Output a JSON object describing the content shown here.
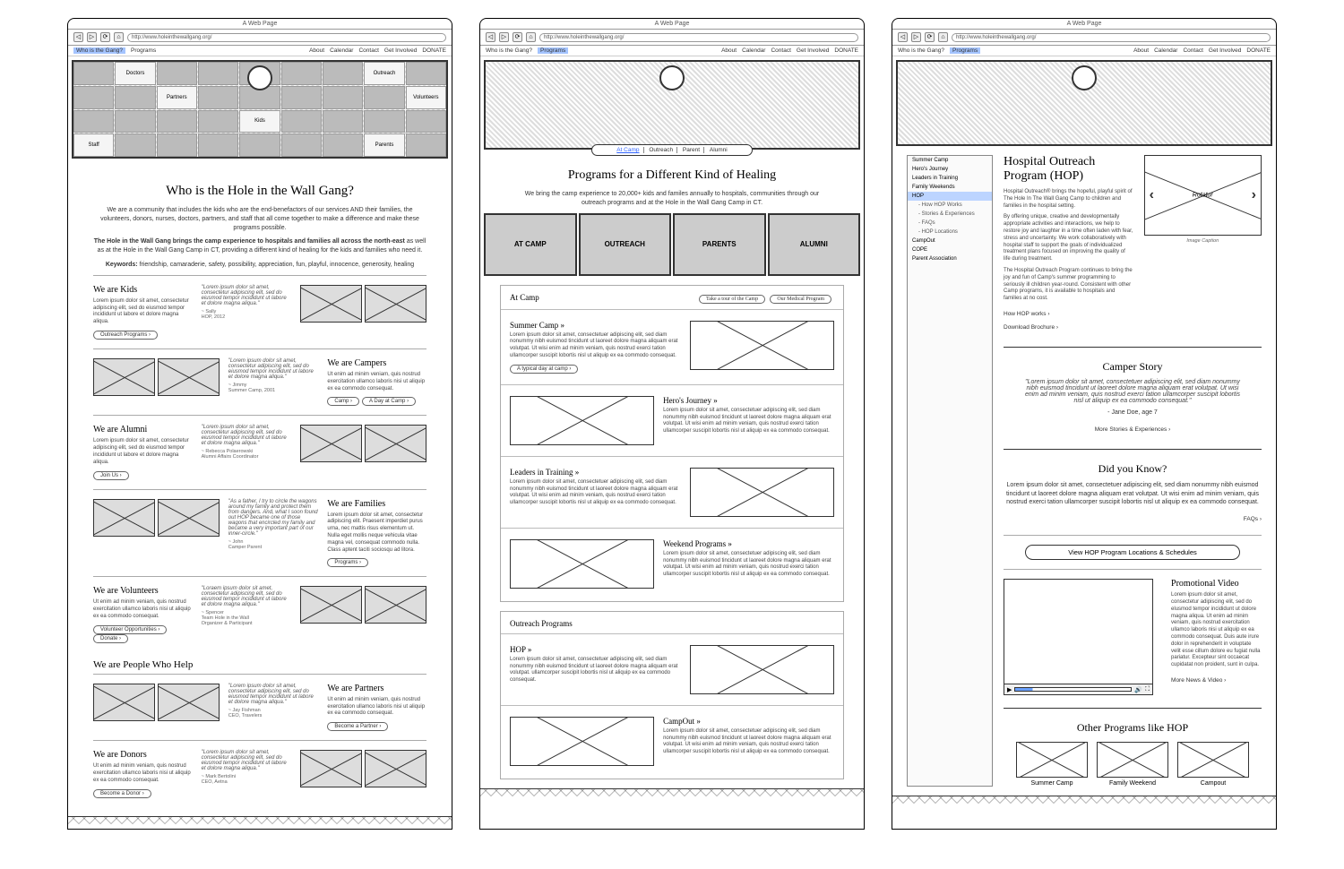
{
  "browser": {
    "title": "A Web Page",
    "url": "http://www.holeinthewallgang.org/"
  },
  "nav": {
    "left": [
      "Who is the Gang?",
      "Programs"
    ],
    "right": [
      "About",
      "Calendar",
      "Contact",
      "Get Involved",
      "DONATE"
    ]
  },
  "page1": {
    "title": "Who is the Hole in the Wall Gang?",
    "intro1": "We are a community that includes the kids who are the end-benefactors of our services AND their families, the volunteers, donors, nurses, doctors, partners, and staff that all come together to make a difference and make these programs possible.",
    "intro2_bold": "The Hole in the Wall Gang brings the camp experience to hospitals and families all across the north-east",
    "intro2_rest": " as well as at the Hole in the Wall Gang Camp in CT, providing a different kind of healing for the kids and families who need it.",
    "keywords_label": "Keywords:",
    "keywords": "friendship, camaraderie, safety, possibility, appreciation, fun, playful, innocence, generosity, healing",
    "facelabels": [
      "Doctors",
      "Partners",
      "Kids",
      "Staff",
      "Outreach",
      "Volunteers",
      "Parents"
    ],
    "sections": [
      {
        "title": "We are Kids",
        "body": "Lorem ipsum dolor sit amet, consectetur adipiscing elit, sed do eiusmod tempor incididunt ut labore et dolore magna aliqua.",
        "quote": "\"Lorem ipsum dolor sit amet, consectetur adipiscing elit, sed do eiusmod tempor incididunt ut labore et dolore magna aliqua.\"",
        "attr": "~ Sally\nHOP, 2012",
        "buttons": [
          "Outreach Programs"
        ]
      },
      {
        "title": "We are Campers",
        "body": "Ut enim ad minim veniam, quis nostrud exercitation ullamco laboris nisi ut aliquip ex ea commodo consequat.",
        "quote": "\"Lorem ipsum dolor sit amet, consectetur adipiscing elit, sed do eiusmod tempor incididunt ut labore et dolore magna aliqua.\"",
        "attr": "~ Jimmy\nSummer Camp, 2001",
        "buttons": [
          "Camp",
          "A Day at Camp"
        ]
      },
      {
        "title": "We are Alumni",
        "body": "Lorem ipsum dolor sit amet, consectetur adipiscing elit, sed do eiusmod tempor incididunt ut labore et dolore magna aliqua.",
        "quote": "\"Lorem ipsum dolor sit amet, consectetur adipiscing elit, sed do eiusmod tempor incididunt ut labore et dolore magna aliqua.\"",
        "attr": "~ Rebecca Polaerowski\nAlumni Affairs Coordinator",
        "buttons": [
          "Join Us"
        ]
      },
      {
        "title": "We are Families",
        "body": "Lorem ipsum dolor sit amet, consectetur adipiscing elit. Praesent imperdiet purus urna, nec mattis risus elementum ut. Nulla eget mollis neque vehicula vitae magna vel, consequat commodo nulla. Class aptent taciti sociosqu ad litora.",
        "quote": "\"As a father, I try to circle the wagons around my family and protect them from dangers. And, what I soon found out HOP became one of those wagons that encircled my family and became a very important part of our inner-circle.\"",
        "attr": "~ John\nCamper Parent",
        "buttons": [
          "Programs"
        ]
      },
      {
        "title": "We are Volunteers",
        "body": "Ut enim ad minim veniam, quis nostrud exercitation ullamco laboris nisi ut aliquip ex ea commodo consequat.",
        "quote": "\"Loraem ipsum dolor sit amet, consectetur adipiscing elit, sed do eiusmod tempor incididunt ut labore et dolore magna aliqua.\"",
        "attr": "~ Spencer\nTeam Hole in the Wall\nOrganizer & Participant",
        "buttons": [
          "Volunteer Opportunities",
          "Donate"
        ]
      },
      {
        "super": "We are People Who Help",
        "title": "We are Partners",
        "body": "Ut enim ad minim veniam, quis nostrud exercitation ullamco laboris nisi ut aliquip ex ea commodo consequat.",
        "quote": "\"Lorem ipsum dolor sit amet, consectetur adipiscing elit, sed do eiusmod tempor incididunt ut labore et dolore magna aliqua.\"",
        "attr": "~ Jay Fishman\nCEO, Travelers",
        "buttons": [
          "Become a Partner"
        ]
      },
      {
        "title": "We are Donors",
        "body": "Ut enim ad minim veniam, quis nostrud exercitation ullamco laboris nisi ut aliquip ex ea commodo consequat.",
        "quote": "\"Lorem ipsum dolor sit amet, consectetur adipiscing elit, sed do eiusmod tempor incididunt ut labore et dolore magna aliqua.\"",
        "attr": "~ Mark Bertolini\nCEO, Aetna",
        "buttons": [
          "Become a Donor"
        ]
      }
    ]
  },
  "page2": {
    "title": "Programs for a Different Kind of Healing",
    "intro": "We bring the camp experience to 20,000+ kids and familes annually to hospitals, communities through our outreach programs and at the Hole in the Wall Gang Camp in CT.",
    "pillbar": [
      "At Camp",
      "Outreach",
      "Parent",
      "Alumni"
    ],
    "thumbs": [
      "AT CAMP",
      "OUTREACH",
      "PARENTS",
      "ALUMNI"
    ],
    "atcamp": {
      "heading": "At Camp",
      "btns": [
        "Take a tour of the Camp",
        "Our Medical Program"
      ],
      "items": [
        {
          "t": "Summer Camp »",
          "b": "Lorem ipsum dolor sit amet, consectetuer adipiscing elit, sed diam nonummy nibh euismod tincidunt ut laoreet dolore magna aliquam erat volutpat. Ut wisi enim ad minim veniam, quis nostrud exerci tation ullamcorper suscipit lobortis nisl ut aliquip ex ea commodo consequat.",
          "pill": "A typical day at camp"
        },
        {
          "t": "Hero's Journey »",
          "b": "Lorem ipsum dolor sit amet, consectetuer adipiscing elit, sed diam nonummy nibh euismod tincidunt ut laoreet dolore magna aliquam erat volutpat. Ut wisi enim ad minim veniam, quis nostrud exerci tation ullamcorper suscipit lobortis nisl ut aliquip ex ea commodo consequat."
        },
        {
          "t": "Leaders in Training »",
          "b": "Lorem ipsum dolor sit amet, consectetuer adipiscing elit, sed diam nonummy nibh euismod tincidunt ut laoreet dolore magna aliquam erat volutpat. Ut wisi enim ad minim veniam, quis nostrud exerci tation ullamcorper suscipit lobortis nisl ut aliquip ex ea commodo consequat."
        },
        {
          "t": "Weekend Programs »",
          "b": "Lorem ipsum dolor sit amet, consectetuer adipiscing elit, sed diam nonummy nibh euismod tincidunt ut laoreet dolore magna aliquam erat volutpat. Ut wisi enim ad minim veniam, quis nostrud exerci tation ullamcorper suscipit lobortis nisl ut aliquip ex ea commodo consequat."
        }
      ]
    },
    "outreach": {
      "heading": "Outreach Programs",
      "items": [
        {
          "t": "HOP »",
          "b": "Lorem ipsum dolor sit amet, consectetuer adipiscing elit, sed diam nonummy nibh euismod tincidunt ut laoreet dolore magna aliquam erat volutpat. ullamcorper suscipit lobortis nisl ut aliquip ex ea commodo consequat."
        },
        {
          "t": "CampOut »",
          "b": "Lorem ipsum dolor sit amet, consectetuer adipiscing elit, sed diam nonummy nibh euismod tincidunt ut laoreet dolore magna aliquam erat volutpat. Ut wisi enim ad minim veniam, quis nostrud exerci tation ullamcorper suscipit lobortis nisl ut aliquip ex ea commodo consequat."
        }
      ]
    }
  },
  "page3": {
    "sidenav": [
      "Summer Camp",
      "Hero's Journey",
      "Leaders in Training",
      "Family Weekends",
      "HOP",
      "- How HOP Works",
      "- Stories & Experiences",
      "- FAQs",
      "- HOP Locations",
      "CampOut",
      "COPE",
      "Parent Association"
    ],
    "sidenav_sel": 4,
    "title": "Hospital Outreach Program (HOP)",
    "p1": "Hospital Outreach® brings the hopeful, playful spirit of The Hole In The Wall Gang Camp to children and families in the hospital setting.",
    "p2": "By offering unique, creative and developmentally appropriate activities and interactions, we help to restore joy and laughter in a time often laden with fear, stress and uncertainty. We work collaboratively with hospital staff to support the goals of individualized treatment plans focused on improving the quality of life during treatment.",
    "p3": "The Hospital Outreach Program continues to bring the joy and fun of Camp's summer programming to seriously ill children year-round. Consistent with other Camp programs, it is available to hospitals and families at no cost.",
    "slider_label": "Rotator",
    "caption": "Image Caption",
    "links": [
      "How HOP works",
      "Download Brochure"
    ],
    "camper_h": "Camper Story",
    "camper_q": "\"Lorem ipsum dolor sit amet, consectetuer adipiscing elit, sed diam nonummy nibh euismod tincidunt ut laoreet dolore magna aliquam erat volutpat. Ut wisi enim ad minim veniam, quis nostrud exerci tation ullamcorper suscipit lobortis nisl ut aliquip ex ea commodo consequat.\"",
    "camper_attr": "- Jane Doe, age 7",
    "camper_link": "More Stories & Experiences",
    "dyk_h": "Did you Know?",
    "dyk_b": "Lorem ipsum dolor sit amet, consectetuer adipiscing elit, sed diam nonummy nibh euismod tincidunt ut laoreet dolore magna aliquam erat volutpat. Ut wisi enim ad minim veniam, quis nostrud exerci tation ullamcorper suscipit lobortis nisl ut aliquip ex ea commodo consequat.",
    "dyk_link": "FAQs",
    "bigpill": "View HOP Program Locations & Schedules",
    "video_h": "Promotional Video",
    "video_b": "Lorem ipsum dolor sit amet, consectetur adipiscing elit, sed do elusmod tempor incididunt ut dolore magna aliqua. Ut enim ad minim veniam, quis nostrud exercitation ullamco laboris nisi ut aliquip ex ea commodo consequat. Duis aute irure dolor in reprehenderit in voluptate velit esse cillum dolore eu fugiat nulla pariatur. Excepteur sint occaecat cupidatat non proident, sunt in culpa.",
    "video_link": "More News & Video",
    "other_h": "Other Programs like HOP",
    "other": [
      "Summer Camp",
      "Family Weekend",
      "Campout"
    ]
  }
}
